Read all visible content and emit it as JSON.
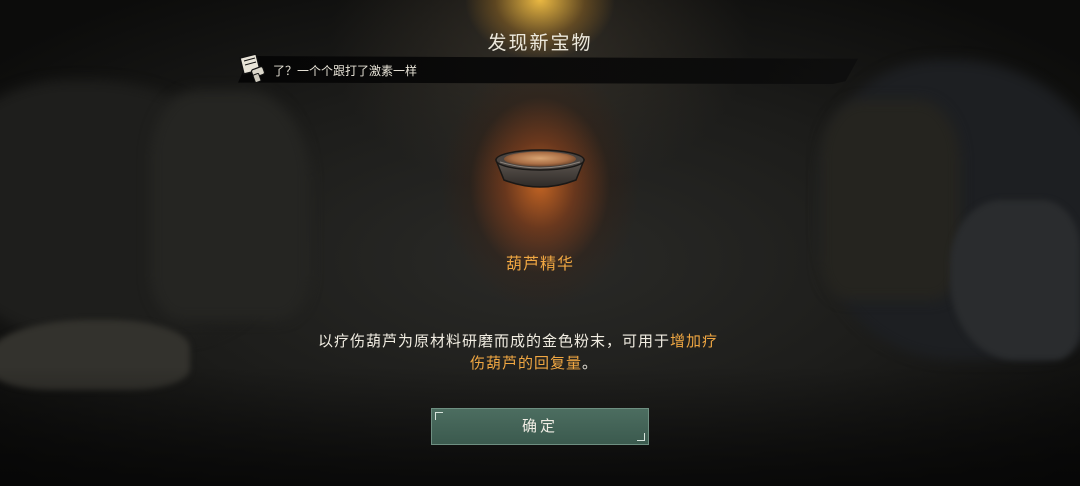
{
  "header": {
    "title": "发现新宝物"
  },
  "dialog": {
    "icon": "scroll-hand-icon",
    "text": "了？一个个跟打了激素一样"
  },
  "item": {
    "icon": "bowl-of-powder-icon",
    "name": "葫芦精华",
    "description_part1": "以疗伤葫芦为原材料研磨而成的金色粉末，可用于",
    "description_highlight1": "增加疗",
    "description_highlight2": "伤葫芦的回复量",
    "description_end": "。"
  },
  "actions": {
    "confirm_label": "确定"
  },
  "colors": {
    "highlight": "#f0a742",
    "button": "#4c6d60",
    "text": "#f1ede2"
  }
}
